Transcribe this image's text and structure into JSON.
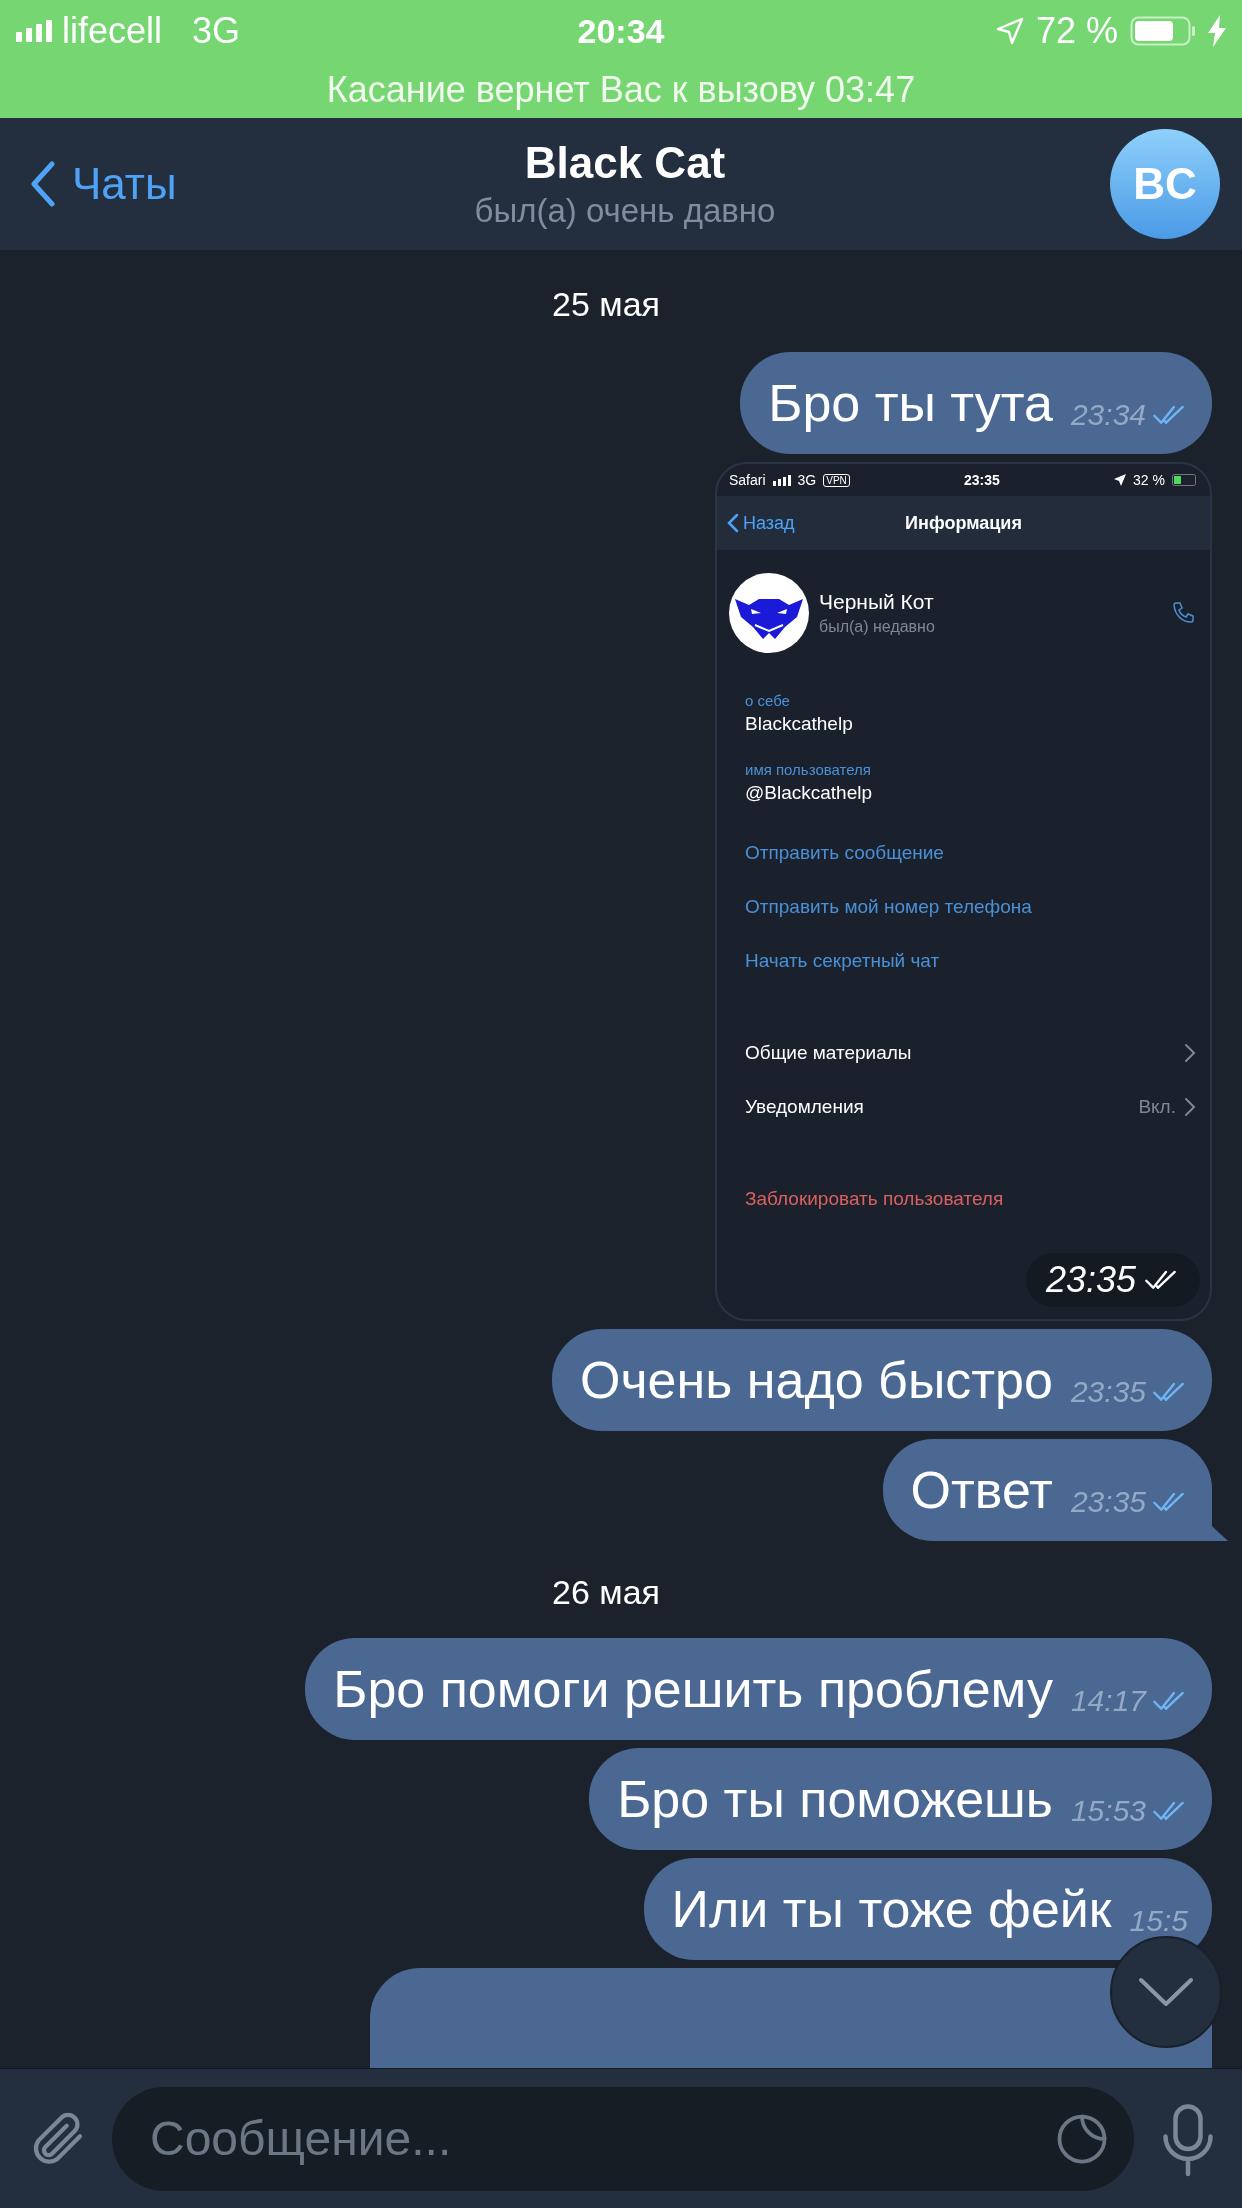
{
  "status_bar": {
    "carrier": "lifecell",
    "network": "3G",
    "time": "20:34",
    "battery": "72 %"
  },
  "call_banner": "Касание вернет Вас к вызову 03:47",
  "header": {
    "back": "Чаты",
    "title": "Black Cat",
    "subtitle": "был(а) очень давно",
    "avatar": "BC"
  },
  "messages": [
    {
      "kind": "date",
      "text": "25 мая"
    },
    {
      "kind": "text",
      "text": "Бро ты тута",
      "time": "23:34",
      "checks": true,
      "tail": false
    },
    {
      "kind": "screenshot",
      "time": "23:35",
      "checks": true,
      "shot": {
        "status": {
          "app": "Safari",
          "network": "3G",
          "vpn": "VPN",
          "time": "23:35",
          "battery": "32 %"
        },
        "back": "Назад",
        "title": "Информация",
        "name": "Черный Кот",
        "presence": "был(а) недавно",
        "fields": [
          {
            "label": "о себе",
            "value": "Blackcathelp"
          },
          {
            "label": "имя пользователя",
            "value": "@Blackcathelp"
          }
        ],
        "actions": [
          "Отправить сообщение",
          "Отправить мой номер телефона",
          "Начать секретный чат"
        ],
        "settings": [
          {
            "label": "Общие материалы"
          },
          {
            "label": "Уведомления",
            "value": "Вкл."
          }
        ],
        "danger": "Заблокировать пользователя"
      }
    },
    {
      "kind": "text",
      "text": "Очень надо быстро",
      "time": "23:35",
      "checks": true,
      "tail": false
    },
    {
      "kind": "text",
      "text": "Ответ",
      "time": "23:35",
      "checks": true,
      "tail": true
    },
    {
      "kind": "date",
      "text": "26 мая"
    },
    {
      "kind": "text",
      "text": "Бро помоги решить проблему",
      "time": "14:17",
      "checks": true,
      "tail": false
    },
    {
      "kind": "text",
      "text": "Бро ты поможешь",
      "time": "15:53",
      "checks": true,
      "tail": false
    },
    {
      "kind": "text",
      "text": "Или ты тоже фейк",
      "time": "15:5",
      "checks": false,
      "tail": false
    },
    {
      "kind": "cut"
    }
  ],
  "composer": {
    "placeholder": "Сообщение..."
  }
}
